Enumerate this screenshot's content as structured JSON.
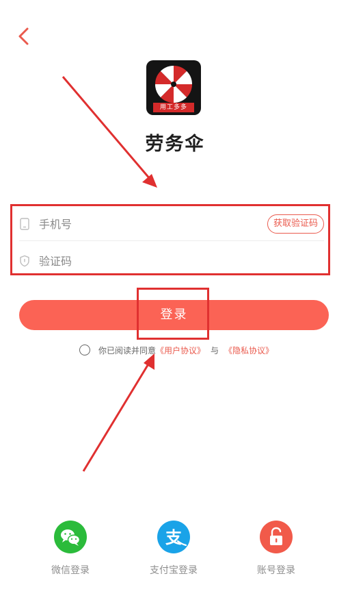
{
  "header": {
    "back_icon": "chevron-left-icon"
  },
  "logo": {
    "caption": "用工多多"
  },
  "app_name": "劳务伞",
  "form": {
    "phone_placeholder": "手机号",
    "code_placeholder": "验证码",
    "get_code_label": "获取验证码"
  },
  "login_label": "登录",
  "agreement": {
    "prefix": "你已阅读并同意",
    "user_agreement": "《用户协议》",
    "separator": "与",
    "privacy_policy": "《隐私协议》"
  },
  "social_logins": [
    {
      "label": "微信登录",
      "icon": "wechat-icon",
      "color": "#2bbb3b"
    },
    {
      "label": "支付宝登录",
      "icon": "alipay-icon",
      "color": "#1aa3e8"
    },
    {
      "label": "账号登录",
      "icon": "lock-icon",
      "color": "#f15a4a"
    }
  ],
  "colors": {
    "accent": "#fb6355",
    "annotation": "#e03030"
  }
}
